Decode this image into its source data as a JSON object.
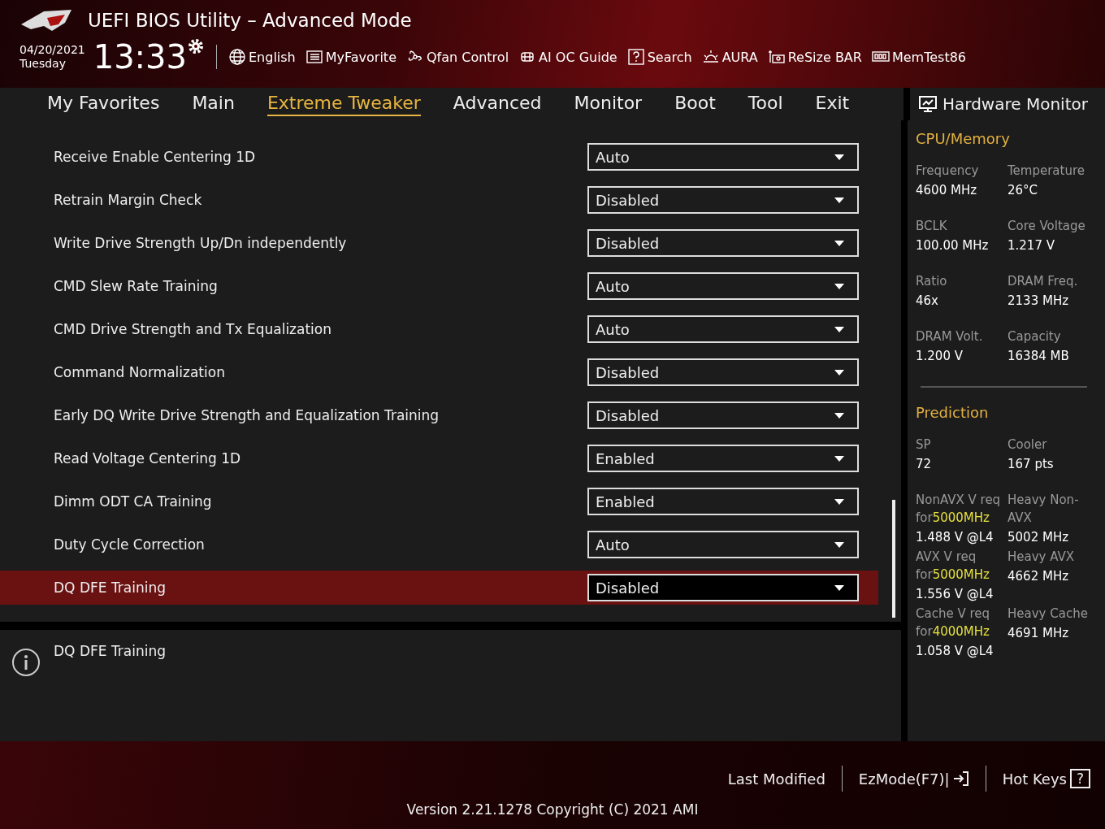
{
  "window": {
    "title": "UEFI BIOS Utility – Advanced Mode"
  },
  "clock": {
    "date": "04/20/2021",
    "weekday": "Tuesday",
    "time": "13:33"
  },
  "toolbar": [
    {
      "label": "English"
    },
    {
      "label": "MyFavorite"
    },
    {
      "label": "Qfan Control"
    },
    {
      "label": "AI OC Guide"
    },
    {
      "label": "Search"
    },
    {
      "label": "AURA"
    },
    {
      "label": "ReSize BAR"
    },
    {
      "label": "MemTest86"
    }
  ],
  "tabs": [
    {
      "label": "My Favorites",
      "selected": false
    },
    {
      "label": "Main",
      "selected": false
    },
    {
      "label": "Extreme Tweaker",
      "selected": true
    },
    {
      "label": "Advanced",
      "selected": false
    },
    {
      "label": "Monitor",
      "selected": false
    },
    {
      "label": "Boot",
      "selected": false
    },
    {
      "label": "Tool",
      "selected": false
    },
    {
      "label": "Exit",
      "selected": false
    }
  ],
  "settings": [
    {
      "label": "Receive Enable Centering 1D",
      "value": "Auto",
      "selected": false
    },
    {
      "label": "Retrain Margin Check",
      "value": "Disabled",
      "selected": false
    },
    {
      "label": "Write Drive Strength Up/Dn independently",
      "value": "Disabled",
      "selected": false
    },
    {
      "label": "CMD Slew Rate Training",
      "value": "Auto",
      "selected": false
    },
    {
      "label": "CMD Drive Strength and Tx Equalization",
      "value": "Auto",
      "selected": false
    },
    {
      "label": "Command Normalization",
      "value": "Disabled",
      "selected": false
    },
    {
      "label": "Early DQ Write Drive Strength and Equalization Training",
      "value": "Disabled",
      "selected": false
    },
    {
      "label": "Read Voltage Centering 1D",
      "value": "Enabled",
      "selected": false
    },
    {
      "label": "Dimm ODT CA Training",
      "value": "Enabled",
      "selected": false
    },
    {
      "label": "Duty Cycle Correction",
      "value": "Auto",
      "selected": false
    },
    {
      "label": "DQ DFE Training",
      "value": "Disabled",
      "selected": true
    }
  ],
  "help": {
    "text": "DQ DFE Training"
  },
  "hardware_monitor": {
    "title": "Hardware Monitor",
    "cpu_memory": {
      "title": "CPU/Memory",
      "items": [
        {
          "label": "Frequency",
          "value": "4600 MHz"
        },
        {
          "label": "Temperature",
          "value": "26°C"
        },
        {
          "label": "BCLK",
          "value": "100.00 MHz"
        },
        {
          "label": "Core Voltage",
          "value": "1.217 V"
        },
        {
          "label": "Ratio",
          "value": "46x"
        },
        {
          "label": "DRAM Freq.",
          "value": "2133 MHz"
        },
        {
          "label": "DRAM Volt.",
          "value": "1.200 V"
        },
        {
          "label": "Capacity",
          "value": "16384 MB"
        }
      ]
    },
    "prediction": {
      "title": "Prediction",
      "items": [
        {
          "label": "SP",
          "value": "72"
        },
        {
          "label": "Cooler",
          "value": "167 pts"
        },
        {
          "label": "NonAVX V req for",
          "accent": "5000MHz",
          "value": "1.488 V @L4"
        },
        {
          "label": "Heavy Non-AVX",
          "value": "5002 MHz"
        },
        {
          "label": "AVX V req for",
          "accent": "5000MHz",
          "value": "1.556 V @L4"
        },
        {
          "label": "Heavy AVX",
          "value": "4662 MHz"
        },
        {
          "label": "Cache V req for",
          "accent": "4000MHz",
          "value": "1.058 V @L4"
        },
        {
          "label": "Heavy Cache",
          "value": "4691 MHz"
        }
      ]
    }
  },
  "footer": {
    "last_modified": "Last Modified",
    "ezmode": "EzMode(F7)|",
    "hotkeys": "Hot Keys",
    "hotkeys_key": "?",
    "version": "Version 2.21.1278 Copyright (C) 2021 AMI"
  }
}
